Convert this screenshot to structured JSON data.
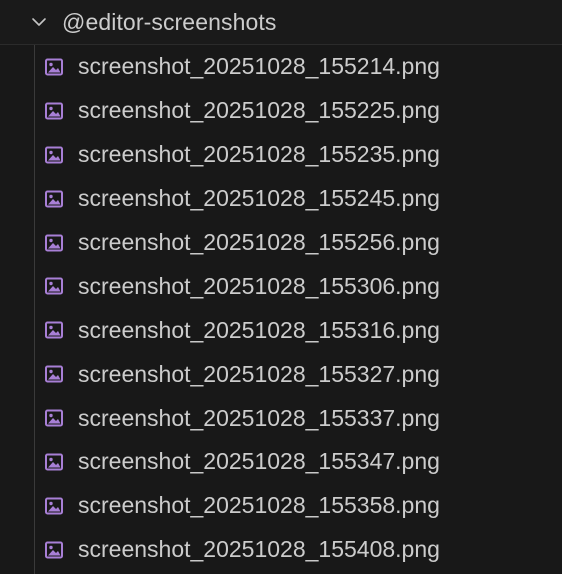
{
  "folder": {
    "name": "@editor-screenshots",
    "expanded": true,
    "chevron_icon": "chevron-down-icon"
  },
  "files": [
    {
      "name": "screenshot_20251028_155214.png",
      "icon": "image-file-icon"
    },
    {
      "name": "screenshot_20251028_155225.png",
      "icon": "image-file-icon"
    },
    {
      "name": "screenshot_20251028_155235.png",
      "icon": "image-file-icon"
    },
    {
      "name": "screenshot_20251028_155245.png",
      "icon": "image-file-icon"
    },
    {
      "name": "screenshot_20251028_155256.png",
      "icon": "image-file-icon"
    },
    {
      "name": "screenshot_20251028_155306.png",
      "icon": "image-file-icon"
    },
    {
      "name": "screenshot_20251028_155316.png",
      "icon": "image-file-icon"
    },
    {
      "name": "screenshot_20251028_155327.png",
      "icon": "image-file-icon"
    },
    {
      "name": "screenshot_20251028_155337.png",
      "icon": "image-file-icon"
    },
    {
      "name": "screenshot_20251028_155347.png",
      "icon": "image-file-icon"
    },
    {
      "name": "screenshot_20251028_155358.png",
      "icon": "image-file-icon"
    },
    {
      "name": "screenshot_20251028_155408.png",
      "icon": "image-file-icon"
    }
  ],
  "colors": {
    "background": "#181818",
    "text": "#cccccc",
    "icon_accent": "#a87fd6",
    "indent_guide": "#3a3a3a"
  }
}
